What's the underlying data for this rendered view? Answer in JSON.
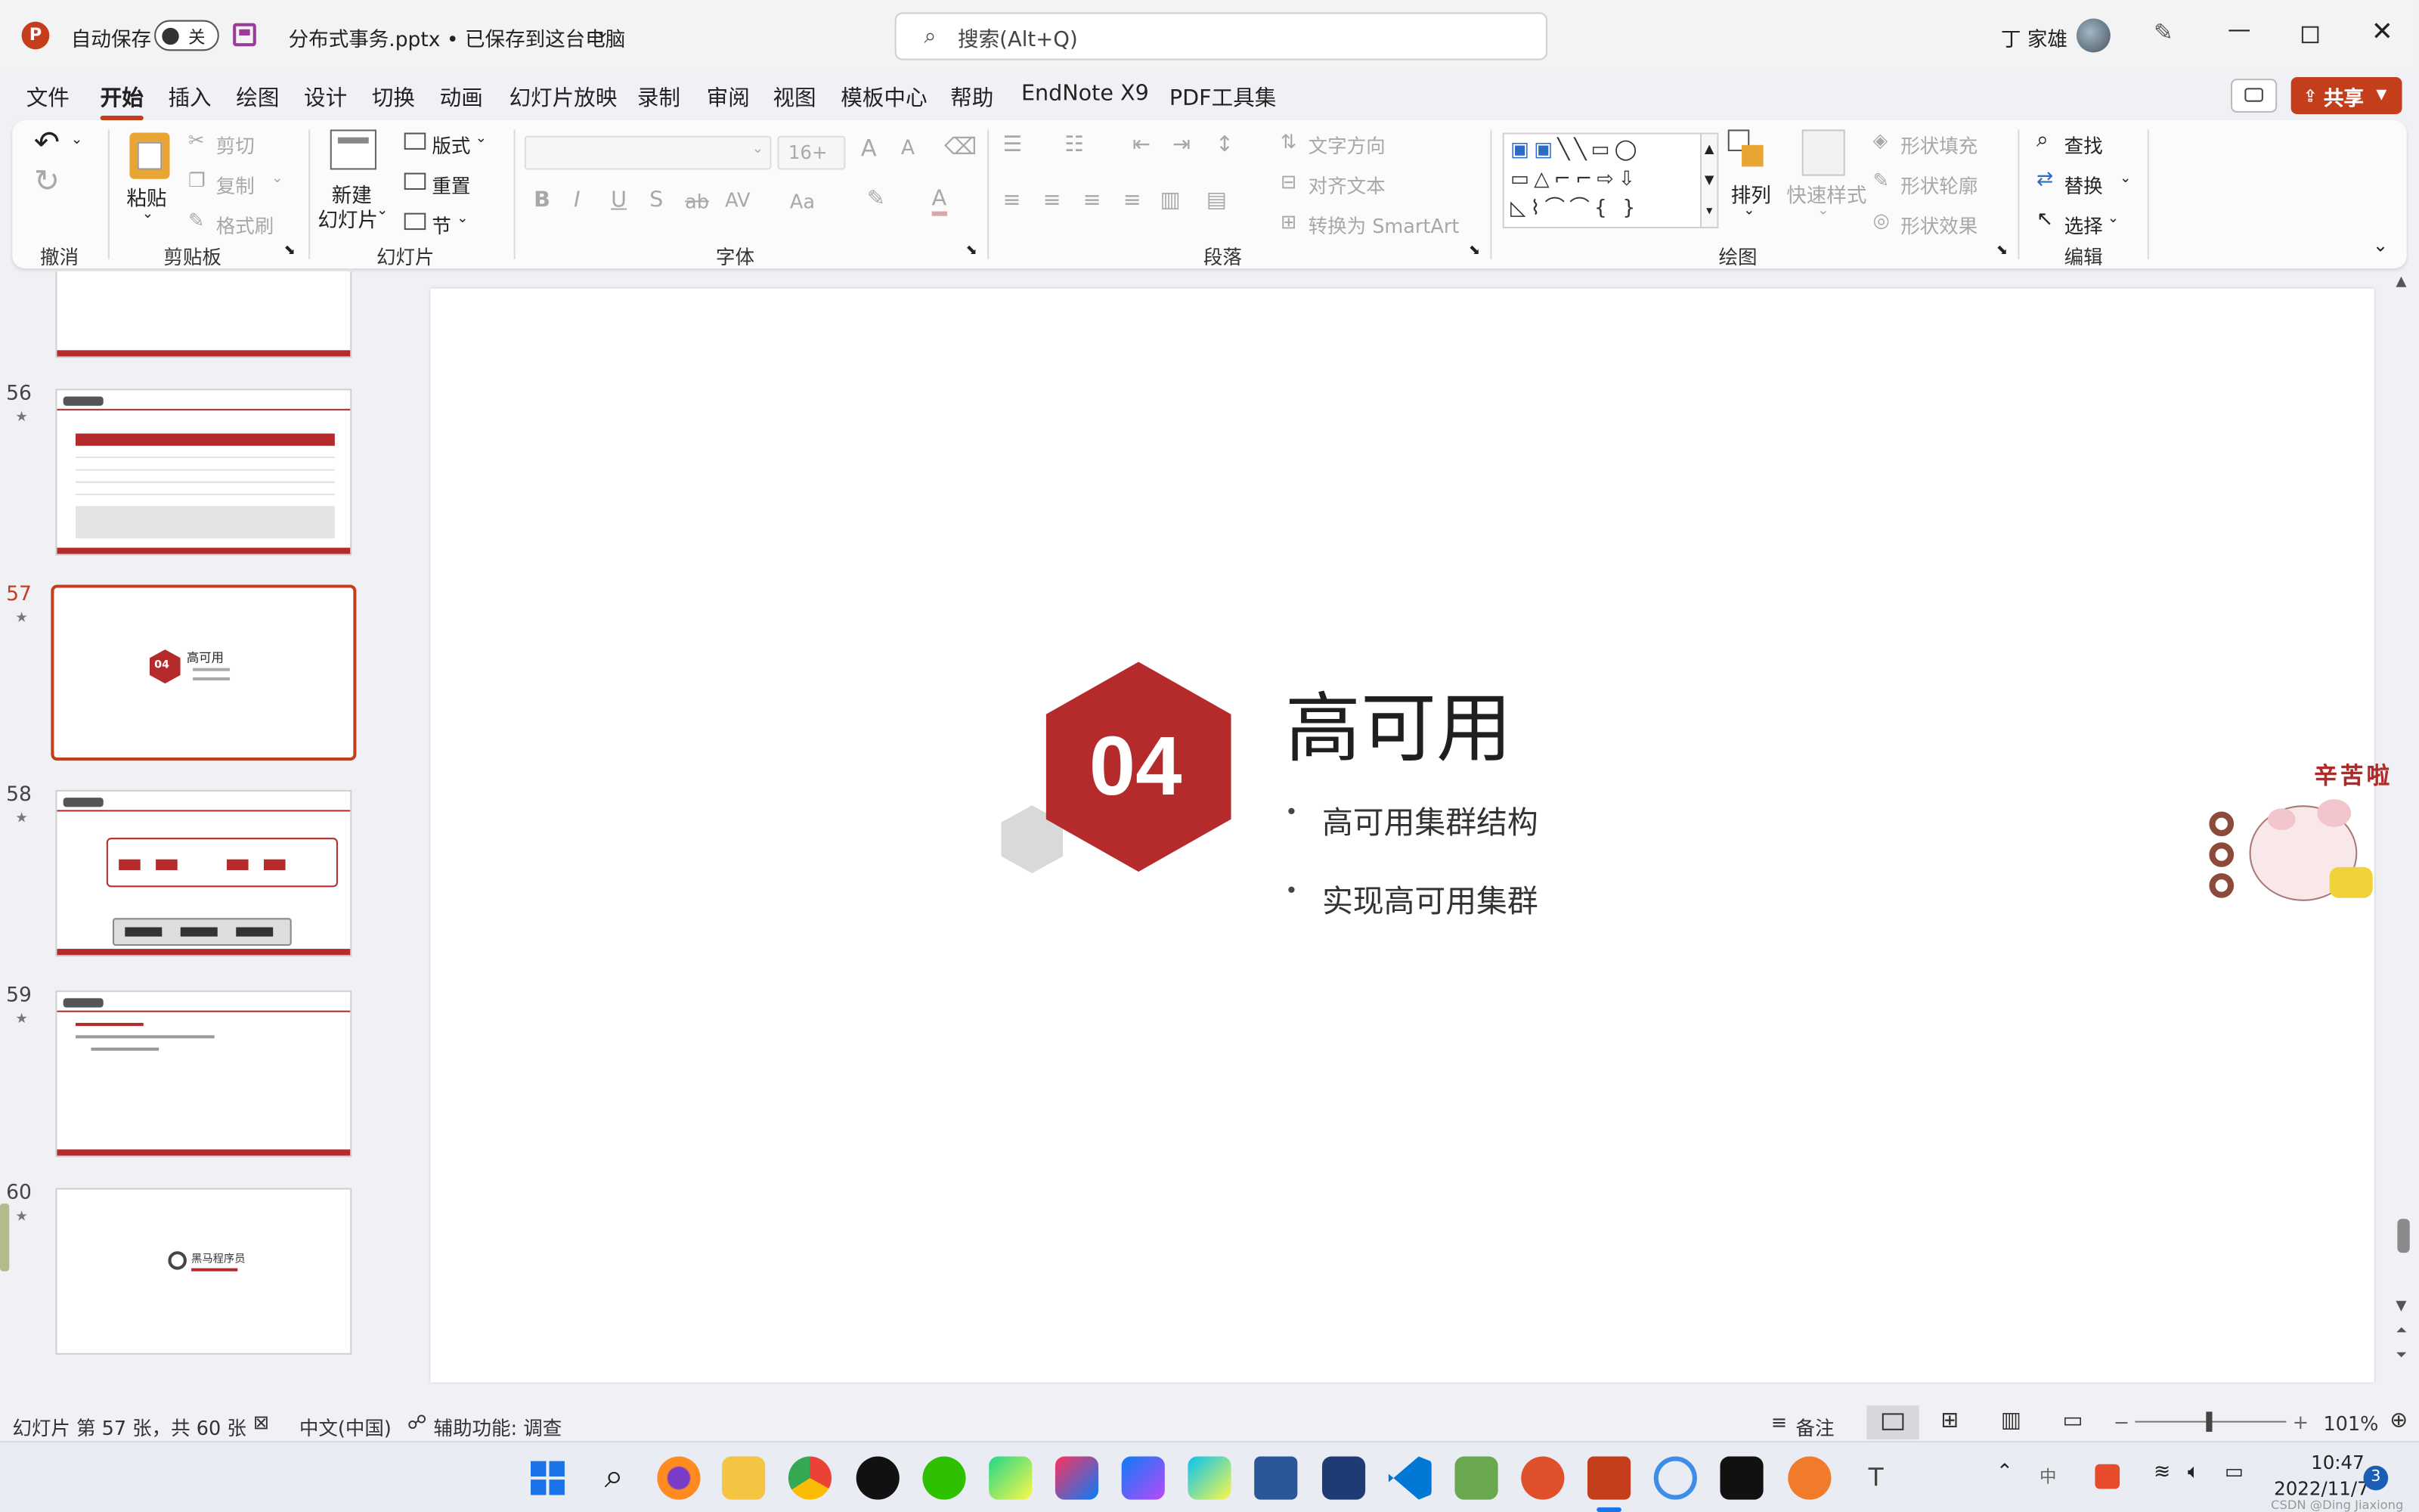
{
  "titlebar": {
    "autosave_label": "自动保存",
    "autosave_state": "关",
    "document_title": "分布式事务.pptx • 已保存到这台电脑",
    "search_placeholder": "搜索(Alt+Q)",
    "user_name": "丁 家雄"
  },
  "menu": {
    "tabs": [
      "文件",
      "开始",
      "插入",
      "绘图",
      "设计",
      "切换",
      "动画",
      "幻灯片放映",
      "录制",
      "审阅",
      "视图",
      "模板中心",
      "帮助",
      "EndNote X9",
      "PDF工具集"
    ],
    "active_tab": "开始",
    "share_label": "共享"
  },
  "ribbon": {
    "groups": {
      "undo": "撤消",
      "clipboard": "剪贴板",
      "slides": "幻灯片",
      "font": "字体",
      "paragraph": "段落",
      "drawing": "绘图",
      "editing": "编辑"
    },
    "clipboard": {
      "paste": "粘贴",
      "cut": "剪切",
      "copy": "复制",
      "format_painter": "格式刷"
    },
    "slides": {
      "new_slide_line1": "新建",
      "new_slide_line2": "幻灯片",
      "layout": "版式",
      "reset": "重置",
      "section": "节"
    },
    "font": {
      "size": "16+",
      "bold": "B",
      "italic": "I",
      "underline": "U",
      "shadow": "S",
      "strike": "ab",
      "spacing": "AV",
      "case": "Aa",
      "font_color": "A",
      "grow": "A",
      "shrink": "A"
    },
    "paragraph": {
      "text_direction": "文字方向",
      "align_text": "对齐文本",
      "smartart": "转换为 SmartArt"
    },
    "drawing": {
      "arrange": "排列",
      "quick_styles": "快速样式",
      "shape_fill": "形状填充",
      "shape_outline": "形状轮廓",
      "shape_effects": "形状效果"
    },
    "editing": {
      "find": "查找",
      "replace": "替换",
      "select": "选择"
    }
  },
  "slides_panel": {
    "items": [
      {
        "number": "56"
      },
      {
        "number": "57"
      },
      {
        "number": "58"
      },
      {
        "number": "59"
      },
      {
        "number": "60"
      }
    ],
    "selected": "57",
    "star": "★",
    "thumb_title": "高可用",
    "thumb_badge": "04",
    "brand": "黑马程序员"
  },
  "slide": {
    "badge_number": "04",
    "title": "高可用",
    "bullets": [
      "高可用集群结构",
      "实现高可用集群"
    ],
    "sticker_text": "辛苦啦"
  },
  "status": {
    "slide_counter": "幻灯片 第 57 张，共 60 张",
    "language": "中文(中国)",
    "accessibility": "辅助功能: 调查",
    "notes": "备注",
    "zoom": "101%"
  },
  "taskbar": {
    "time": "10:47",
    "date": "2022/11/7",
    "notification_count": "3",
    "watermark": "CSDN @Ding Jiaxiong",
    "input_method": "中"
  },
  "colors": {
    "accent": "#c43e1c",
    "slide_red": "#b52a2a",
    "hex_gray": "#d9d9d9"
  }
}
